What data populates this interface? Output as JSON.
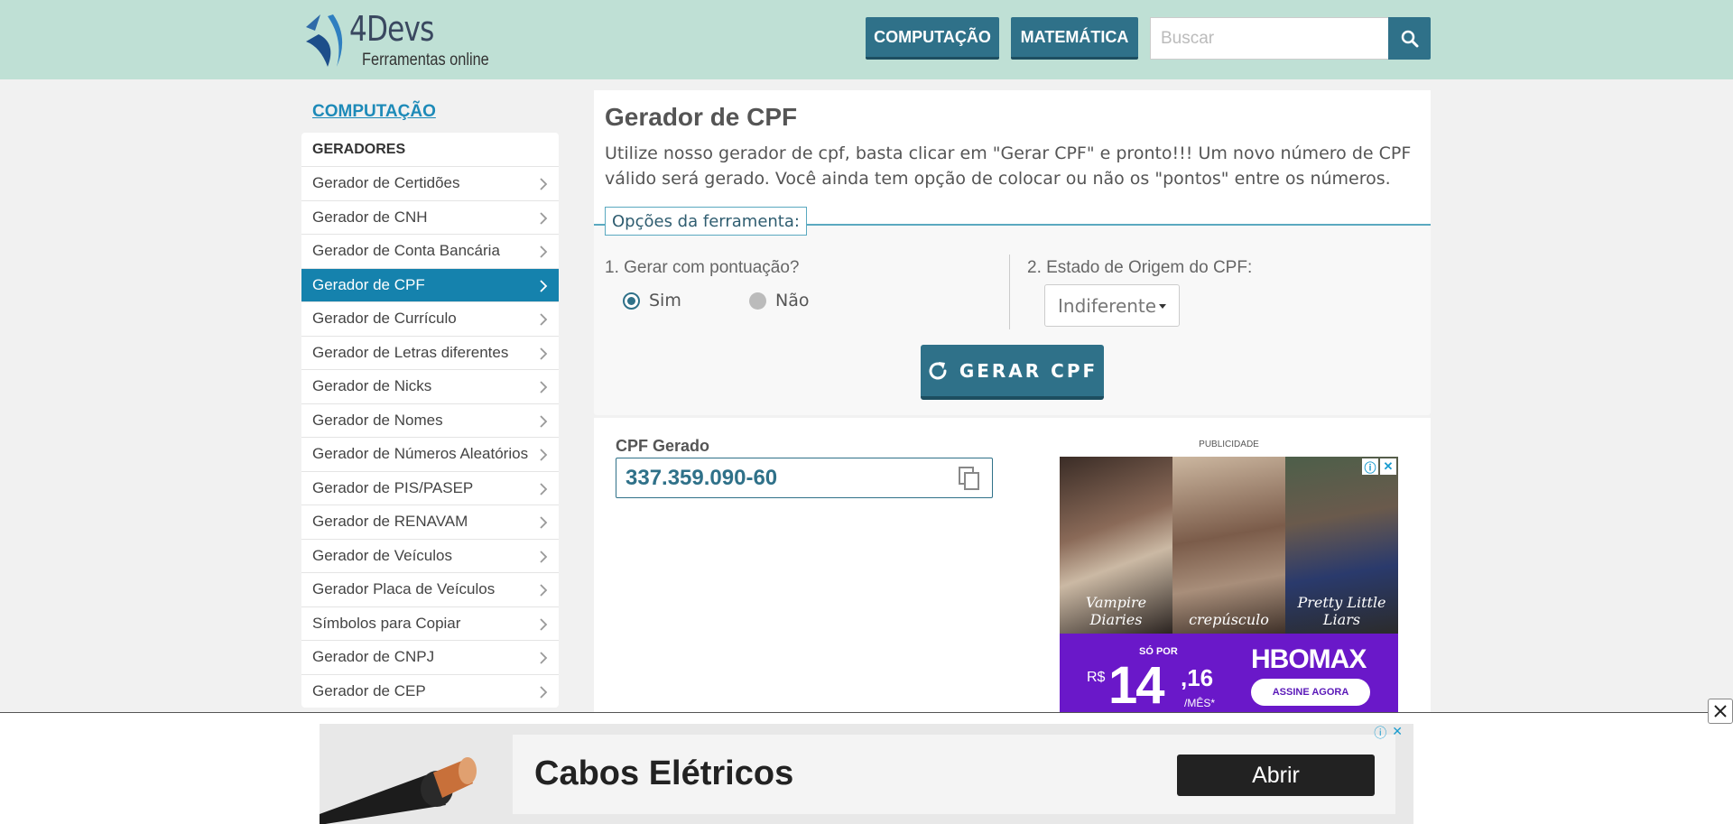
{
  "header": {
    "logo_title": "4Devs",
    "logo_subtitle": "Ferramentas online",
    "nav": [
      "COMPUTAÇÃO",
      "MATEMÁTICA"
    ],
    "search_placeholder": "Buscar"
  },
  "sidebar": {
    "title": "COMPUTAÇÃO",
    "section": "GERADORES",
    "items": [
      "Gerador de Certidões",
      "Gerador de CNH",
      "Gerador de Conta Bancária",
      "Gerador de CPF",
      "Gerador de Currículo",
      "Gerador de Letras diferentes",
      "Gerador de Nicks",
      "Gerador de Nomes",
      "Gerador de Números Aleatórios",
      "Gerador de PIS/PASEP",
      "Gerador de RENAVAM",
      "Gerador de Veículos",
      "Gerador Placa de Veículos",
      "Símbolos para Copiar",
      "Gerador de CNPJ",
      "Gerador de CEP"
    ],
    "active_item": "Gerador de CPF"
  },
  "main": {
    "title": "Gerador de CPF",
    "description": "Utilize nosso gerador de cpf, basta clicar em \"Gerar CPF\" e pronto!!! Um novo número de CPF válido será gerado. Você ainda tem opção de colocar ou não os \"pontos\" entre os números.",
    "options_legend": "Opções da ferramenta:",
    "q1_label": "1. Gerar com pontuação?",
    "radio_yes": "Sim",
    "radio_no": "Não",
    "radio_selected": "Sim",
    "q2_label": "2. Estado de Origem do CPF:",
    "state_selected": "Indiferente",
    "generate_button": "GERAR CPF",
    "result_label": "CPF Gerado",
    "result_value": "337.359.090-60"
  },
  "ad_right": {
    "label": "PUBLICIDADE",
    "captions": [
      "Vampire Diaries",
      "crepúsculo",
      "Pretty Little Liars"
    ],
    "so_por": "SÓ POR",
    "currency": "R$",
    "price_int": "14",
    "price_cents": ",16",
    "per": "/MÊS*",
    "brand": "HBOMAX",
    "cta": "ASSINE AGORA"
  },
  "ad_bottom": {
    "title": "Cabos Elétricos",
    "cta": "Abrir"
  },
  "colors": {
    "header_bg": "#bfe0d5",
    "primary": "#2f7189",
    "active_sidebar": "#1582ad",
    "link": "#1d8ab8"
  }
}
